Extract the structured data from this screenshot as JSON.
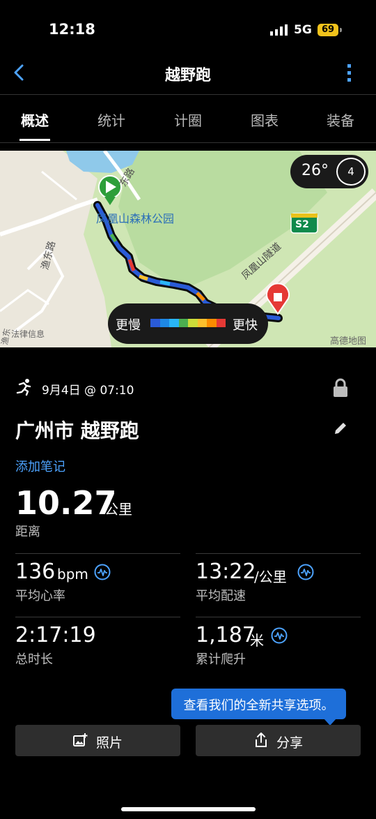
{
  "status_bar": {
    "time": "12:18",
    "network": "5G",
    "battery": "69"
  },
  "header": {
    "title": "越野跑"
  },
  "tabs": [
    {
      "label": "概述",
      "active": true
    },
    {
      "label": "统计",
      "active": false
    },
    {
      "label": "计圈",
      "active": false
    },
    {
      "label": "图表",
      "active": false
    },
    {
      "label": "装备",
      "active": false
    }
  ],
  "map": {
    "temperature": "26°",
    "wind_level": "4",
    "park_label": "凤凰山森林公园",
    "road_label_1": "东路",
    "road_label_2": "渔东路",
    "tunnel_label": "凤凰山隧道",
    "highway_badge": "S2",
    "poi_label": "法律信息",
    "poi_label_2": "渔东",
    "attribution": "高德地图",
    "legend_slow": "更慢",
    "legend_fast": "更快",
    "legend_colors": [
      "#2a5bd7",
      "#1e88e5",
      "#29b6f6",
      "#4caf50",
      "#cddc39",
      "#fbc02d",
      "#fb8c00",
      "#e53935"
    ]
  },
  "activity": {
    "date": "9月4日 @ 07:10",
    "title": "广州市 越野跑",
    "add_note": "添加笔记",
    "distance_value": "10.27",
    "distance_unit": "公里",
    "distance_label": "距离"
  },
  "stats": {
    "hr_value": "136",
    "hr_unit": "bpm",
    "hr_label": "平均心率",
    "pace_value": "13:22",
    "pace_unit": "/公里",
    "pace_label": "平均配速",
    "duration_value": "2:17:19",
    "duration_label": "总时长",
    "ascent_value": "1,187",
    "ascent_unit": "米",
    "ascent_label": "累计爬升"
  },
  "tooltip": {
    "text": "查看我们的全新共享选项。"
  },
  "buttons": {
    "photos": "照片",
    "share": "分享"
  },
  "colors": {
    "accent": "#4da3ff",
    "tooltip": "#1e6fd9",
    "battery": "#f1c21b"
  }
}
